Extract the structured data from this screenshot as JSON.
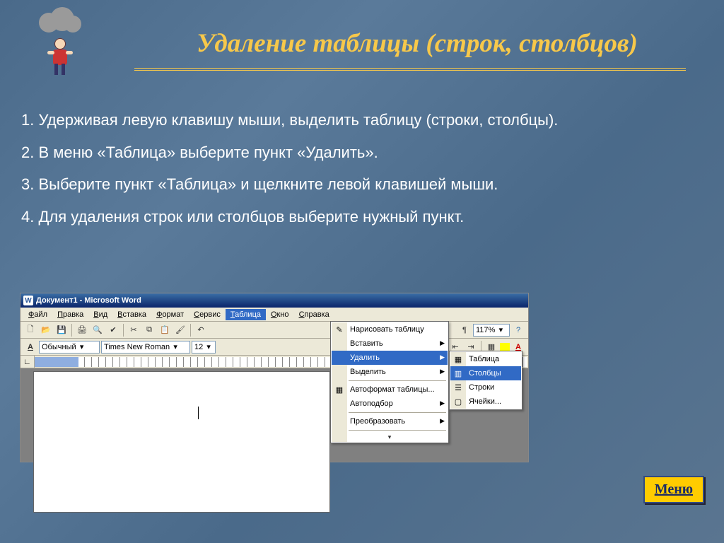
{
  "slide": {
    "title": "Удаление таблицы (строк, столбцов)",
    "steps": [
      "1. Удерживая левую клавишу мыши, выделить таблицу (строки, столбцы).",
      "2. В меню «Таблица» выберите пункт «Удалить».",
      "3. Выберите пункт «Таблица» и щелкните левой клавишей мыши.",
      "4. Для удаления строк или столбцов выберите нужный пункт."
    ],
    "menu_button": "Меню"
  },
  "word": {
    "title": "Документ1 - Microsoft Word",
    "menubar": [
      "Файл",
      "Правка",
      "Вид",
      "Вставка",
      "Формат",
      "Сервис",
      "Таблица",
      "Окно",
      "Справка"
    ],
    "menubar_active_index": 6,
    "toolbar1": {
      "zoom": "117%"
    },
    "toolbar2": {
      "style": "Обычный",
      "font": "Times New Roman",
      "size": "12"
    },
    "table_menu": {
      "items": [
        {
          "label": "Нарисовать таблицу",
          "icon": "pencil-icon"
        },
        {
          "label": "Вставить",
          "submenu": true
        },
        {
          "label": "Удалить",
          "submenu": true,
          "selected": true
        },
        {
          "label": "Выделить",
          "submenu": true
        },
        {
          "sep": true
        },
        {
          "label": "Автоформат таблицы...",
          "icon": "autoformat-icon"
        },
        {
          "label": "Автоподбор",
          "submenu": true
        },
        {
          "sep": true
        },
        {
          "label": "Преобразовать",
          "submenu": true
        }
      ]
    },
    "delete_submenu": {
      "items": [
        {
          "label": "Таблица",
          "icon": "delete-table-icon"
        },
        {
          "label": "Столбцы",
          "icon": "delete-columns-icon",
          "selected": true
        },
        {
          "label": "Строки",
          "icon": "delete-rows-icon"
        },
        {
          "label": "Ячейки...",
          "icon": "delete-cells-icon"
        }
      ]
    }
  }
}
